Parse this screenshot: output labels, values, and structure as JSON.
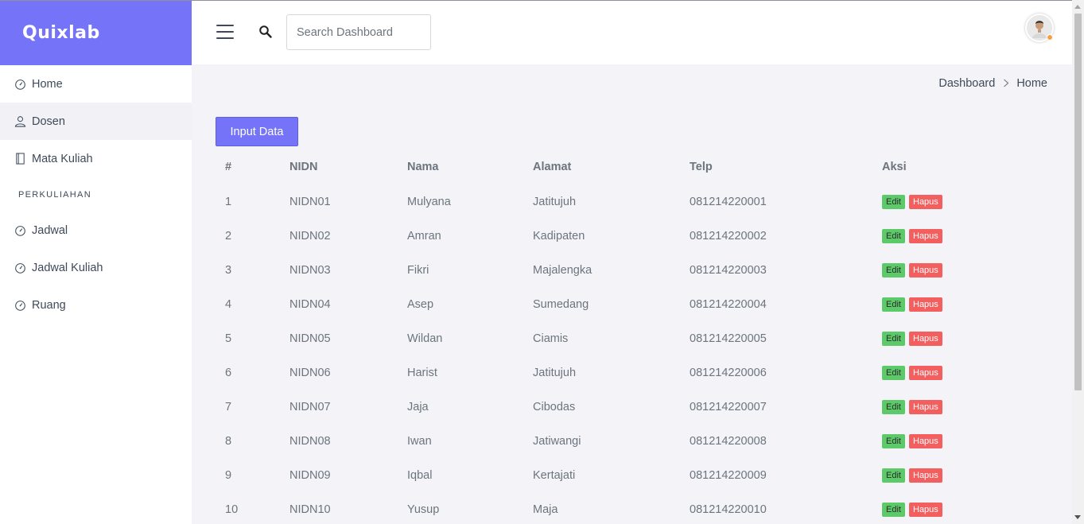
{
  "brand": {
    "name": "Quixlab"
  },
  "sidebar": {
    "items": [
      {
        "label": "Home",
        "icon": "speedometer-icon",
        "active": false
      },
      {
        "label": "Dosen",
        "icon": "user-icon",
        "active": true
      },
      {
        "label": "Mata Kuliah",
        "icon": "notebook-icon",
        "active": false
      }
    ],
    "section": "PERKULIAHAN",
    "items2": [
      {
        "label": "Jadwal",
        "icon": "speedometer-icon"
      },
      {
        "label": "Jadwal Kuliah",
        "icon": "speedometer-icon"
      },
      {
        "label": "Ruang",
        "icon": "speedometer-icon"
      }
    ]
  },
  "header": {
    "search_placeholder": "Search Dashboard",
    "menu_icon": "hamburger-icon",
    "search_icon": "search-icon",
    "avatar_status_color": "#f6a141"
  },
  "breadcrumb": {
    "parent": "Dashboard",
    "current": "Home"
  },
  "main": {
    "input_button": "Input Data",
    "table": {
      "headers": [
        "#",
        "NIDN",
        "Nama",
        "Alamat",
        "Telp",
        "Aksi"
      ],
      "rows": [
        [
          "1",
          "NIDN01",
          "Mulyana",
          "Jatitujuh",
          "081214220001"
        ],
        [
          "2",
          "NIDN02",
          "Amran",
          "Kadipaten",
          "081214220002"
        ],
        [
          "3",
          "NIDN03",
          "Fikri",
          "Majalengka",
          "081214220003"
        ],
        [
          "4",
          "NIDN04",
          "Asep",
          "Sumedang",
          "081214220004"
        ],
        [
          "5",
          "NIDN05",
          "Wildan",
          "Ciamis",
          "081214220005"
        ],
        [
          "6",
          "NIDN06",
          "Harist",
          "Jatitujuh",
          "081214220006"
        ],
        [
          "7",
          "NIDN07",
          "Jaja",
          "Cibodas",
          "081214220007"
        ],
        [
          "8",
          "NIDN08",
          "Iwan",
          "Jatiwangi",
          "081214220008"
        ],
        [
          "9",
          "NIDN09",
          "Iqbal",
          "Kertajati",
          "081214220009"
        ],
        [
          "10",
          "NIDN10",
          "Yusup",
          "Maja",
          "081214220010"
        ]
      ],
      "edit_label": "Edit",
      "delete_label": "Hapus"
    }
  },
  "colors": {
    "accent": "#7573f7",
    "edit": "#5dca6a",
    "delete": "#f35e5e"
  }
}
